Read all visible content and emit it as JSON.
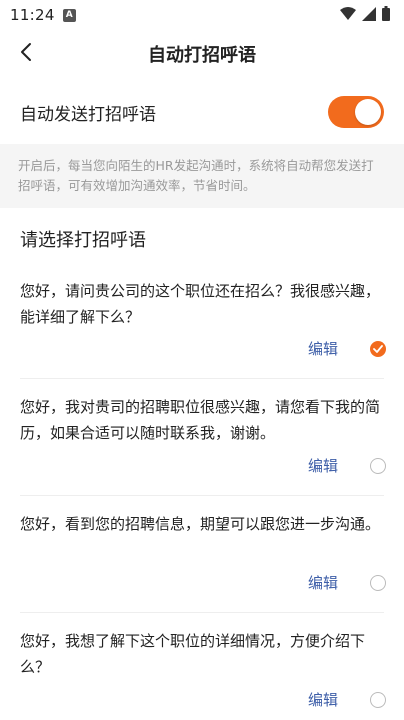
{
  "status_bar": {
    "time": "11:24",
    "notification_badge": "A"
  },
  "header": {
    "title": "自动打招呼语"
  },
  "auto_send": {
    "label": "自动发送打招呼语",
    "enabled": true
  },
  "hint": {
    "text": "开启后，每当您向陌生的HR发起沟通时，系统将自动帮您发送打招呼语，可有效增加沟通效率，节省时间。"
  },
  "section": {
    "title": "请选择打招呼语"
  },
  "greetings": [
    {
      "text": "您好，请问贵公司的这个职位还在招么？我很感兴趣，能详细了解下么？",
      "edit_label": "编辑",
      "selected": true
    },
    {
      "text": "您好，我对贵司的招聘职位很感兴趣，请您看下我的简历，如果合适可以随时联系我，谢谢。",
      "edit_label": "编辑",
      "selected": false
    },
    {
      "text": "您好，看到您的招聘信息，期望可以跟您进一步沟通。",
      "edit_label": "编辑",
      "selected": false
    },
    {
      "text": "您好，我想了解下这个职位的详细情况，方便介绍下么？",
      "edit_label": "编辑",
      "selected": false
    }
  ],
  "colors": {
    "accent": "#f26b1d",
    "link": "#3d5ea8",
    "hint_bg": "#f5f5f5"
  }
}
